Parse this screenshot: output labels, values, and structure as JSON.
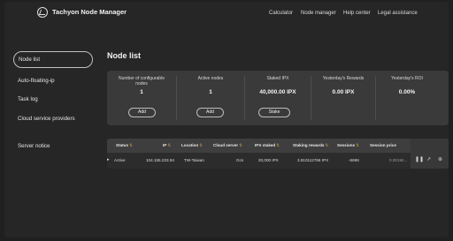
{
  "app": {
    "title": "Tachyon Node Manager"
  },
  "nav": {
    "items": [
      "Calculator",
      "Node manager",
      "Help center",
      "Legal assistance"
    ]
  },
  "sidebar": {
    "items": [
      {
        "label": "Node list",
        "active": true
      },
      {
        "label": "Auto-floating-ip"
      },
      {
        "label": "Task log"
      },
      {
        "label": "Cloud service providers"
      },
      {
        "label": "Server notice"
      }
    ]
  },
  "page": {
    "title": "Node list"
  },
  "stats": [
    {
      "label": "Number of configurable nodes",
      "value": "1",
      "button": "Add"
    },
    {
      "label": "Active nodes",
      "value": "1",
      "button": "Add"
    },
    {
      "label": "Staked IPX",
      "value": "40,000.00 IPX",
      "button": "Stake"
    },
    {
      "label": "Yesterday's Rewards",
      "value": "0.00 IPX"
    },
    {
      "label": "Yesterday's ROI",
      "value": "0.00%"
    }
  ],
  "table": {
    "columns": [
      "Status",
      "IP",
      "Location",
      "Cloud server",
      "IPX staked",
      "Staking rewards",
      "Sessions",
      "Session price"
    ],
    "rows": [
      {
        "status": "Active",
        "ip": "104.155.233.94",
        "location": "TW-Taiwan",
        "cloud_server": "Gcs",
        "ipx_staked": "20,000 IPX",
        "staking_rewards": "3.910112766 IPX",
        "sessions": "-6698",
        "session_price": "0.00194..."
      }
    ]
  },
  "icons": {
    "expand": "chevron-right-icon",
    "pause": "pause-icon",
    "external": "external-link-icon",
    "more": "more-icon",
    "sort": "sort-icon",
    "logo": "tachyon-logo-icon"
  }
}
